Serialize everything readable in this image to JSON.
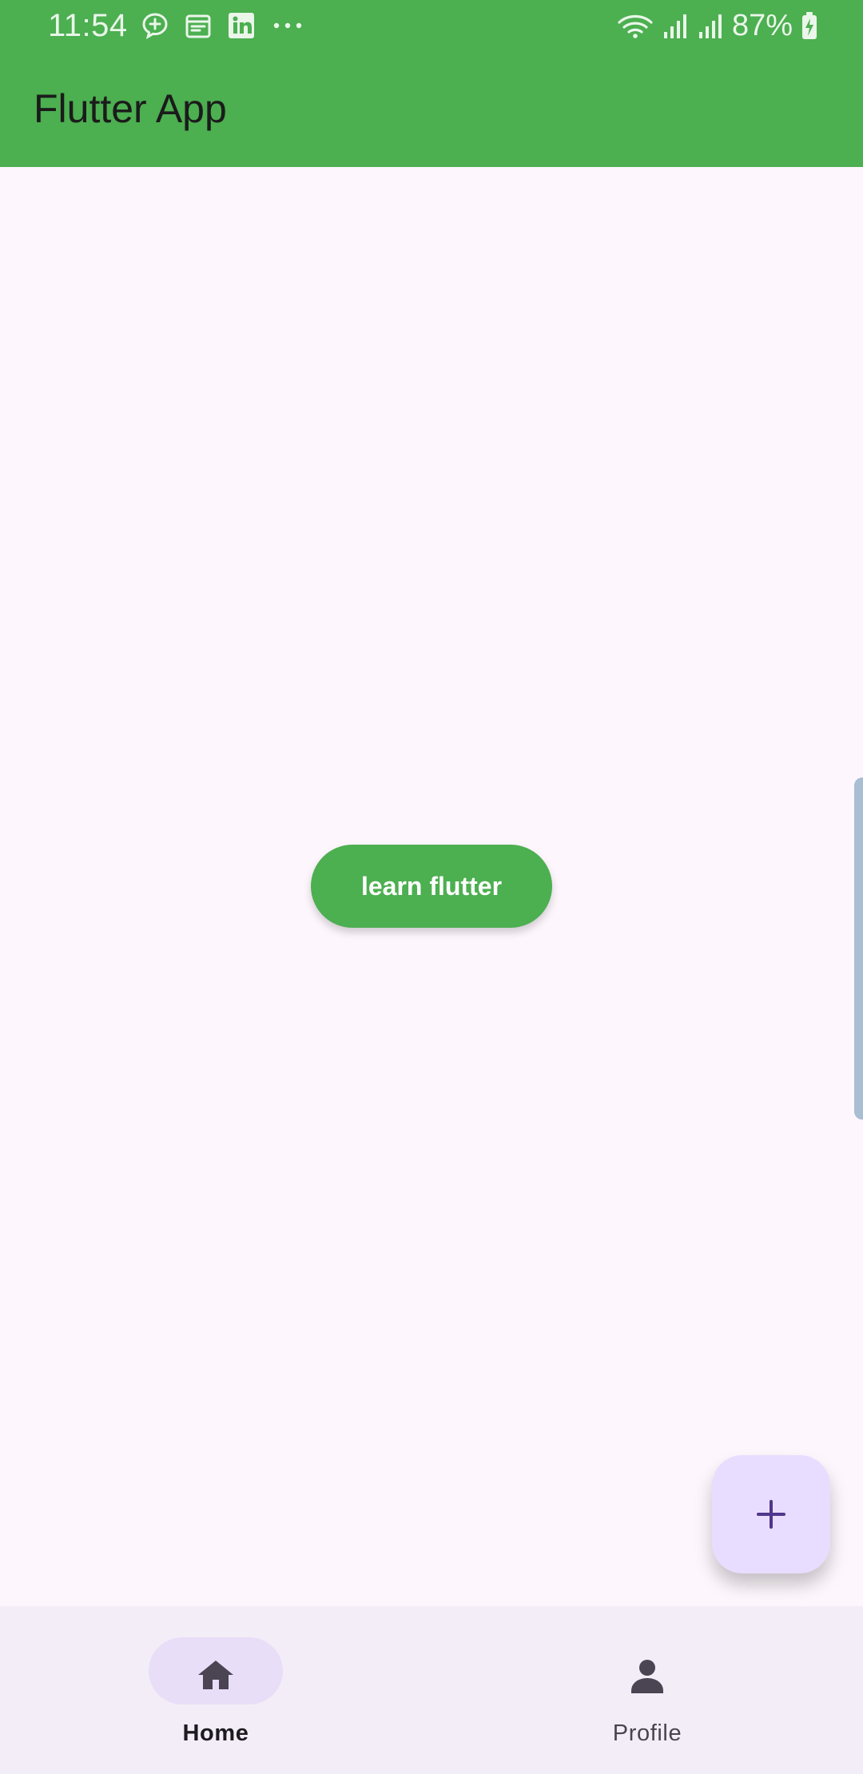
{
  "status_bar": {
    "time": "11:54",
    "battery_percent": "87%",
    "left_icons": [
      "chat-plus-icon",
      "calendar-icon",
      "linkedin-icon",
      "more-horiz-icon"
    ],
    "right_icons": [
      "wifi-icon",
      "cell-signal-icon",
      "cell-signal-icon",
      "battery-charging-icon"
    ]
  },
  "app_bar": {
    "title": "Flutter App",
    "background_color": "#4CAF50"
  },
  "main": {
    "learn_button_label": "learn flutter",
    "learn_button_color": "#4CAF50"
  },
  "fab": {
    "icon": "add-icon",
    "background_color": "#E9DDFF",
    "icon_color": "#4F378B"
  },
  "bottom_nav": {
    "items": [
      {
        "label": "Home",
        "icon": "home-icon",
        "selected": true
      },
      {
        "label": "Profile",
        "icon": "person-icon",
        "selected": false
      }
    ],
    "background_color": "#F3EDF7",
    "selected_pill_color": "#E8DEF8"
  }
}
